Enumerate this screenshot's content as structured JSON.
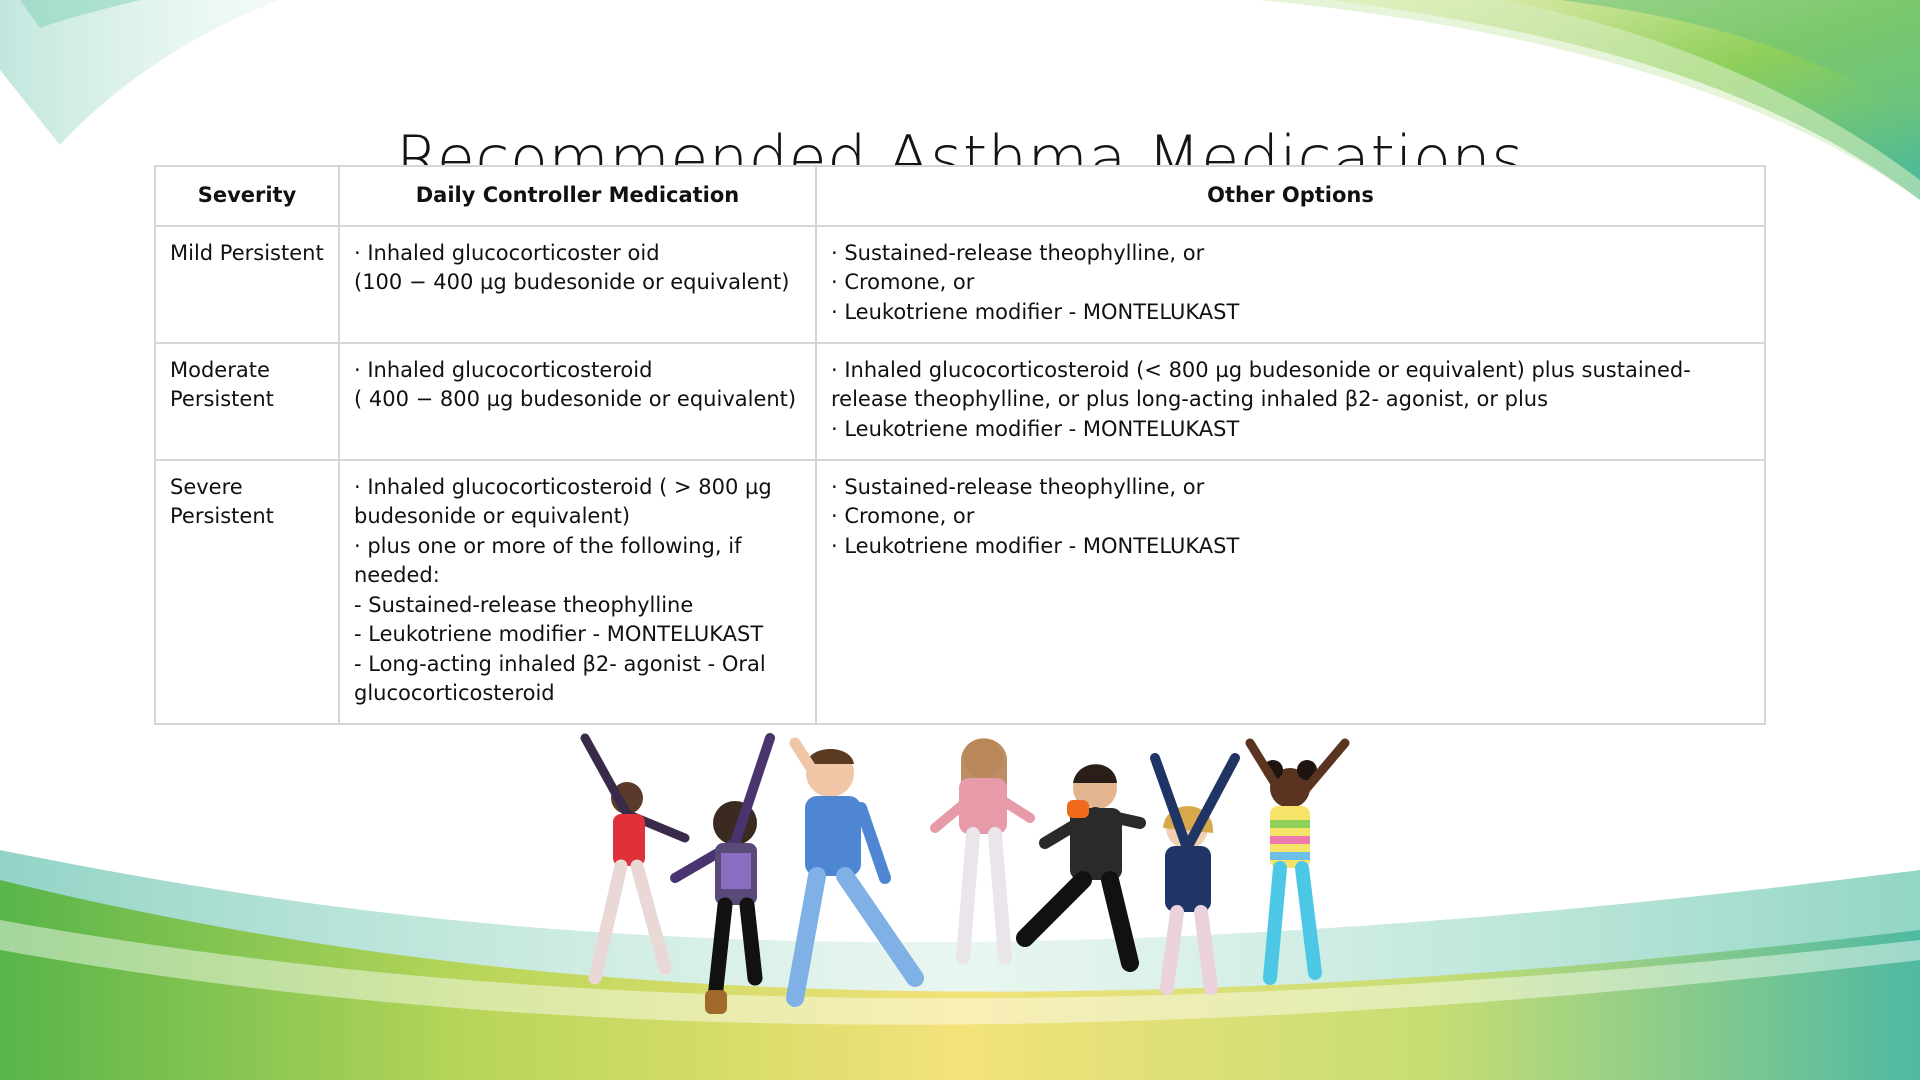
{
  "slide": {
    "title": "Recommended Asthma Medications"
  },
  "table": {
    "headers": [
      "Severity",
      "Daily Controller Medication",
      "Other Options"
    ],
    "rows": [
      {
        "severity": [
          "Mild Persistent"
        ],
        "daily": [
          "· Inhaled glucocorticoster oid",
          "(100 − 400 µg budesonide or equivalent)"
        ],
        "other": [
          "· Sustained-release theophylline, or",
          "· Cromone, or",
          "· Leukotriene modifier - MONTELUKAST"
        ]
      },
      {
        "severity": [
          "Moderate",
          "Persistent"
        ],
        "daily": [
          "· Inhaled glucocorticosteroid",
          "( 400 − 800 µg budesonide or equivalent)"
        ],
        "other": [
          "· Inhaled glucocorticosteroid (< 800 µg budesonide or equivalent) plus sustained-release theophylline, or plus long-acting inhaled β2- agonist, or plus",
          "· Leukotriene modifier - MONTELUKAST"
        ]
      },
      {
        "severity": [
          "Severe",
          "Persistent"
        ],
        "daily": [
          "· Inhaled glucocorticosteroid ( > 800 µg budesonide or equivalent)",
          "· plus one or more of the following, if needed:",
          "- Sustained-release theophylline",
          "- Leukotriene modifier - MONTELUKAST",
          "- Long-acting inhaled β2- agonist - Oral glucocorticosteroid"
        ],
        "other": [
          "· Sustained-release theophylline, or",
          "· Cromone, or",
          "· Leukotriene modifier - MONTELUKAST"
        ]
      }
    ]
  },
  "colors": {
    "green_dark": "#5bb84a",
    "green_light": "#a9d46b",
    "teal": "#6ec6b0",
    "yellow": "#f3e27a",
    "border": "#d6d6d6"
  },
  "illustration": {
    "icon": "jumping-children-photo"
  }
}
